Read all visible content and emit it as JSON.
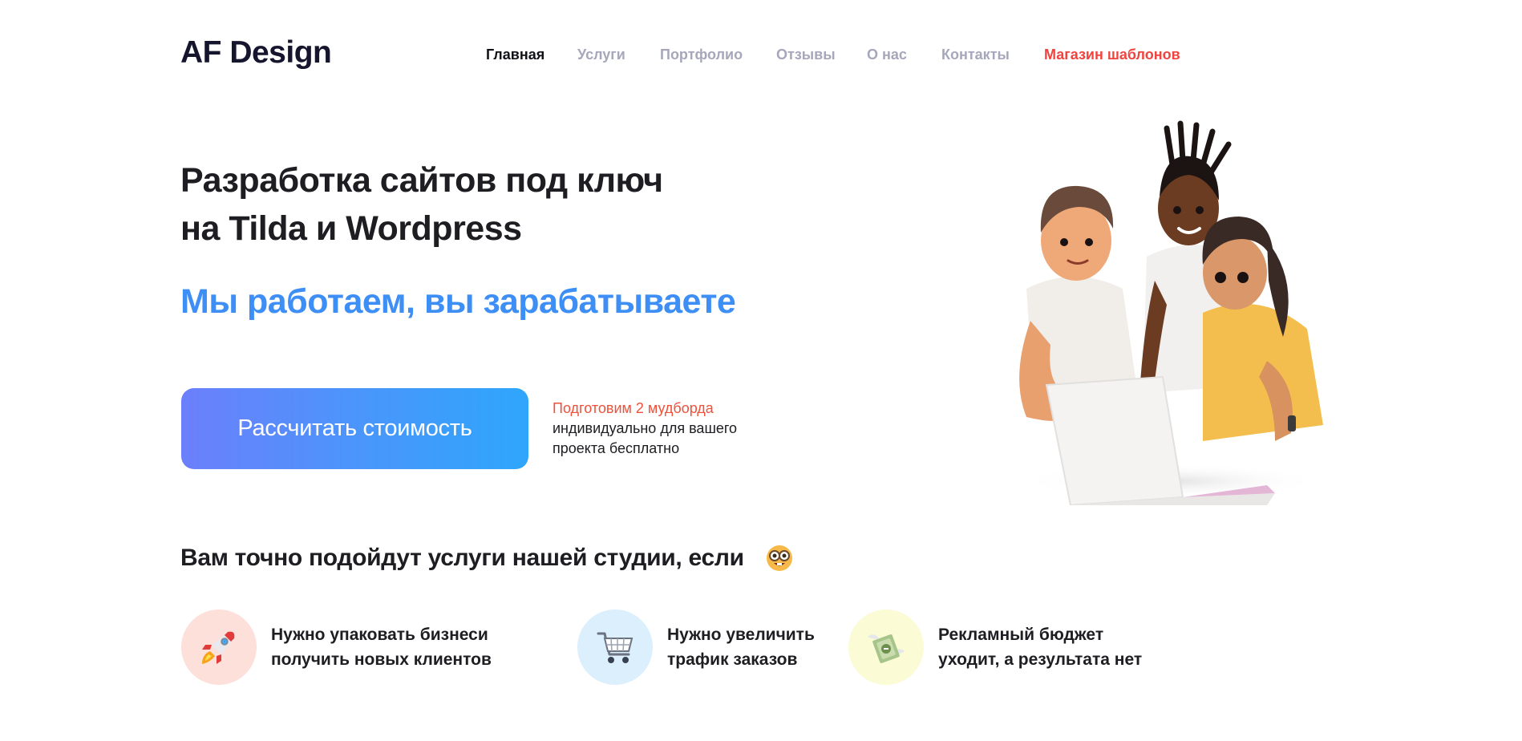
{
  "header": {
    "logo": "AF Design",
    "nav": [
      {
        "label": "Главная",
        "active": true
      },
      {
        "label": "Услуги"
      },
      {
        "label": "Портфолио"
      },
      {
        "label": "Отзывы"
      },
      {
        "label": "О нас"
      },
      {
        "label": "Контакты"
      },
      {
        "label": "Магазин шаблонов",
        "highlight": true
      }
    ]
  },
  "hero": {
    "title_line1": "Разработка сайтов под ключ",
    "title_line2": "на Tilda и Wordpress",
    "subtitle": "Мы работаем, вы зарабатываете",
    "cta_label": "Рассчитать стоимость",
    "note_accent": "Подготовим 2 мудборда",
    "note_line2": "индивидуально для вашего",
    "note_line3": "проекта бесплатно"
  },
  "section": {
    "title": "Вам точно подойдут услуги нашей студии, если",
    "emoji": "nerd-face-icon",
    "features": [
      {
        "icon": "rocket-icon",
        "line1": "Нужно упаковать бизнеси",
        "line2": "получить новых клиентов"
      },
      {
        "icon": "shopping-cart-icon",
        "line1": "Нужно увеличить",
        "line2": "трафик заказов"
      },
      {
        "icon": "flying-money-icon",
        "line1": "Рекламный бюджет",
        "line2": "уходит, а результата нет"
      }
    ]
  },
  "colors": {
    "accent_blue": "#3d8ef5",
    "accent_red": "#f0443f",
    "nav_inactive": "#a6a7ba",
    "cta_gradient_start": "#6c7ffb",
    "cta_gradient_end": "#2ea6fb"
  }
}
